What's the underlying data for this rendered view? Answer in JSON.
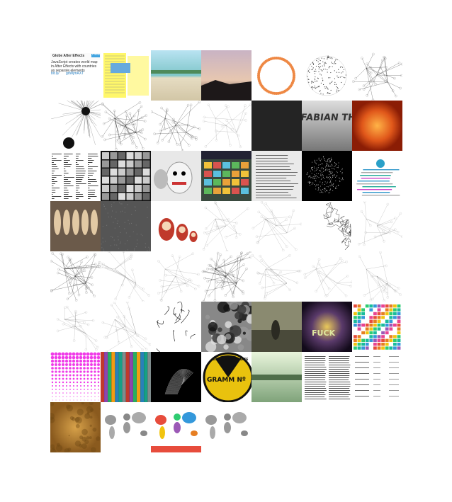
{
  "gallery": {
    "title": "",
    "tiles": [
      {
        "kind": "tweet",
        "text": "Globe After Effects",
        "sub": "JavaScript creates world map in After Effects with countries as separate elements",
        "link": "bit.ly/",
        "code": "gdWjmAXT",
        "btn": "Follow"
      },
      {
        "kind": "notes"
      },
      {
        "kind": "beach"
      },
      {
        "kind": "sunset"
      },
      {
        "kind": "ring"
      },
      {
        "kind": "dotcircle"
      },
      {
        "kind": "network",
        "variant": "light"
      },
      {
        "kind": "fireworks"
      },
      {
        "kind": "network",
        "variant": "dense"
      },
      {
        "kind": "network",
        "variant": "light"
      },
      {
        "kind": "network",
        "variant": "faint"
      },
      {
        "kind": "dark"
      },
      {
        "kind": "metal3d",
        "text": "FABIAN THEBUI"
      },
      {
        "kind": "fire"
      },
      {
        "kind": "textcols"
      },
      {
        "kind": "thumbgrid"
      },
      {
        "kind": "puppet"
      },
      {
        "kind": "schedule",
        "header": "Weekly"
      },
      {
        "kind": "doc"
      },
      {
        "kind": "blackcircle"
      },
      {
        "kind": "infographic"
      },
      {
        "kind": "figures"
      },
      {
        "kind": "stone"
      },
      {
        "kind": "dolls"
      },
      {
        "kind": "network",
        "variant": "faint"
      },
      {
        "kind": "network",
        "variant": "faint"
      },
      {
        "kind": "tangle"
      },
      {
        "kind": "network",
        "variant": "faint"
      },
      {
        "kind": "network",
        "variant": "dense"
      },
      {
        "kind": "network",
        "variant": "faint"
      },
      {
        "kind": "network",
        "variant": "faint"
      },
      {
        "kind": "network",
        "variant": "dense"
      },
      {
        "kind": "network",
        "variant": "faint"
      },
      {
        "kind": "network",
        "variant": "faint"
      },
      {
        "kind": "network",
        "variant": "faint"
      },
      {
        "kind": "network",
        "variant": "faint"
      },
      {
        "kind": "network",
        "variant": "faint"
      },
      {
        "kind": "strands"
      },
      {
        "kind": "bubbles"
      },
      {
        "kind": "street"
      },
      {
        "kind": "glow",
        "text": "FUCK"
      },
      {
        "kind": "colorgrid"
      },
      {
        "kind": "pinkdots"
      },
      {
        "kind": "stripes"
      },
      {
        "kind": "blackswirl"
      },
      {
        "kind": "badge",
        "text1": "STAHL-STECKKARTE",
        "text2": "GRAMM Nº"
      },
      {
        "kind": "greenstreet"
      },
      {
        "kind": "article"
      },
      {
        "kind": "table"
      },
      {
        "kind": "venus"
      },
      {
        "kind": "worldmap",
        "variant": "grey"
      },
      {
        "kind": "worldmap",
        "variant": "color"
      },
      {
        "kind": "worldmap",
        "variant": "plain"
      }
    ]
  }
}
